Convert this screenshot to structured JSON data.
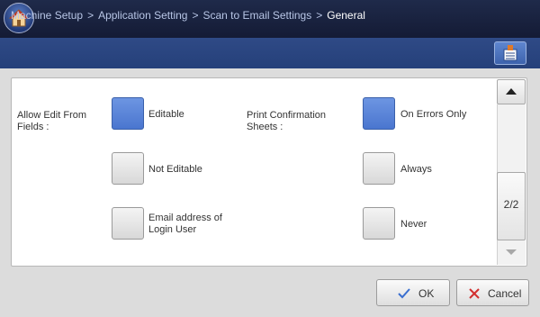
{
  "breadcrumb": {
    "items": [
      "Machine Setup",
      "Application Setting",
      "Scan to Email Settings"
    ],
    "current": "General",
    "separator": ">"
  },
  "icons": {
    "home": "home-icon",
    "settings_list": "settings-list-icon",
    "scroll_up": "arrow-up-icon",
    "scroll_down": "arrow-down-icon",
    "ok": "checkmark-icon",
    "cancel": "x-icon"
  },
  "allow_edit": {
    "label": "Allow Edit From Fields :",
    "options": [
      "Editable",
      "Not Editable",
      "Email address of Login User"
    ],
    "selected": "Editable"
  },
  "print_confirmation": {
    "label": "Print Confirmation Sheets :",
    "options": [
      "On Errors Only",
      "Always",
      "Never"
    ],
    "selected": "On Errors Only"
  },
  "scroll": {
    "page_indicator": "2/2"
  },
  "buttons": {
    "ok": "OK",
    "cancel": "Cancel"
  },
  "colors": {
    "selected": "#5a84d8",
    "topbar": "#1a2340",
    "crumbbar": "#2d4783"
  }
}
